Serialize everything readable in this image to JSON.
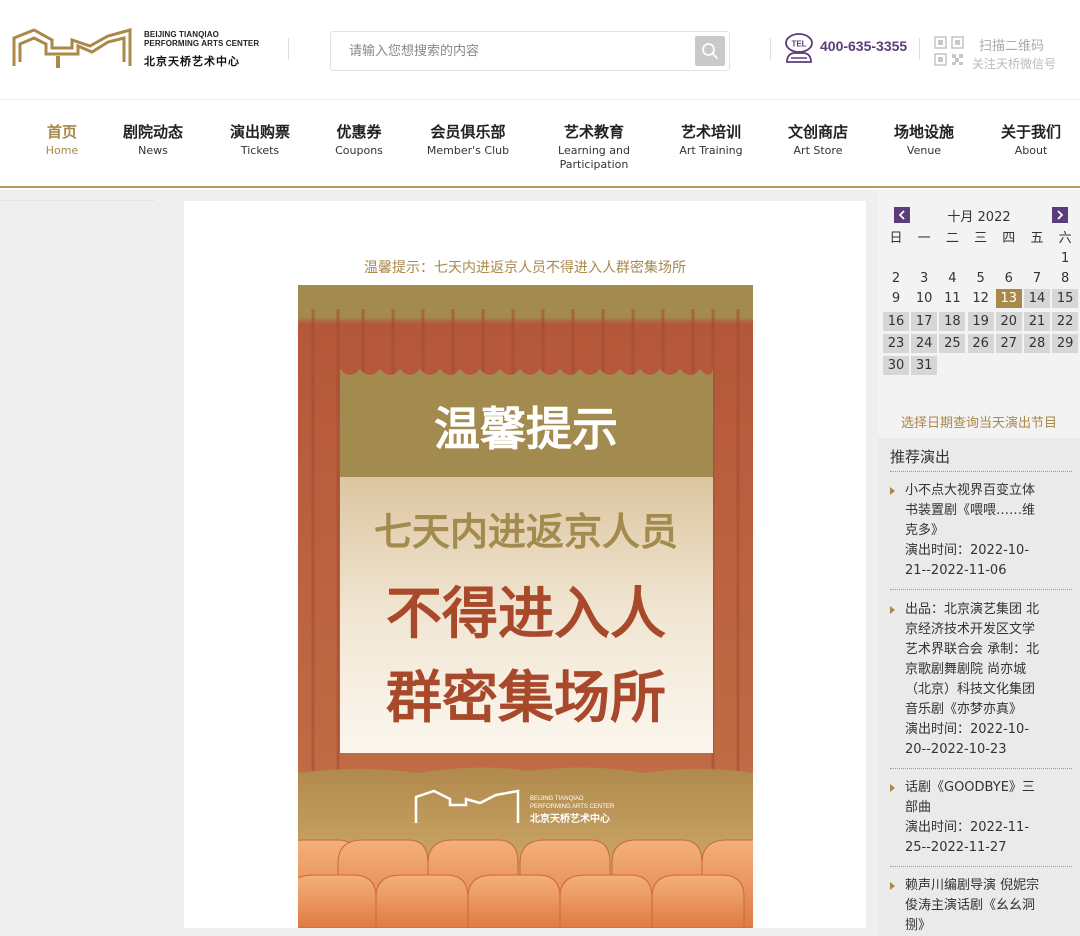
{
  "header": {
    "logo_en_line1": "BEIJING TIANQIAO",
    "logo_en_line2": "PERFORMING ARTS CENTER",
    "logo_cn": "北京天桥艺术中心",
    "search_placeholder": "请输入您想搜索的内容",
    "tel_label": "TEL",
    "phone": "400-635-3355",
    "qr_title": "扫描二维码",
    "qr_subtitle": "关注天桥微信号"
  },
  "nav": [
    {
      "cn": "首页",
      "en": "Home",
      "active": true
    },
    {
      "cn": "剧院动态",
      "en": "News"
    },
    {
      "cn": "演出购票",
      "en": "Tickets"
    },
    {
      "cn": "优惠券",
      "en": "Coupons"
    },
    {
      "cn": "会员俱乐部",
      "en": "Member's Club"
    },
    {
      "cn": "艺术教育",
      "en": "Learning and",
      "en2": "Participation"
    },
    {
      "cn": "艺术培训",
      "en": "Art Training"
    },
    {
      "cn": "文创商店",
      "en": "Art Store"
    },
    {
      "cn": "场地设施",
      "en": "Venue"
    },
    {
      "cn": "关于我们",
      "en": "About"
    }
  ],
  "main": {
    "notice_title": "温馨提示：七天内进返京人员不得进入人群密集场所",
    "poster": {
      "heading": "温馨提示",
      "line1": "七天内进返京人员",
      "line2": "不得进入人",
      "line3": "群密集场所",
      "logo_en_line1": "BEIJING TIANQIAO",
      "logo_en_line2": "PERFORMING ARTS CENTER",
      "logo_cn": "北京天桥艺术中心"
    }
  },
  "calendar": {
    "title": "十月 2022",
    "weekdays": [
      "日",
      "一",
      "二",
      "三",
      "四",
      "五",
      "六"
    ],
    "today": 13,
    "hint": "选择日期查询当天演出节目"
  },
  "recommend": {
    "title": "推荐演出",
    "items": [
      {
        "lines": [
          "小不点大视界百变立体",
          "书装置剧《喂喂……维",
          "克多》",
          "演出时间：2022-10-",
          "21--2022-11-06"
        ]
      },
      {
        "lines": [
          "出品：北京演艺集团 北",
          "京经济技术开发区文学",
          "艺术界联合会 承制：北",
          "京歌剧舞剧院 尚亦城",
          "（北京）科技文化集团",
          "音乐剧《亦梦亦真》",
          "演出时间：2022-10-",
          "20--2022-10-23"
        ]
      },
      {
        "lines": [
          "话剧《GOODBYE》三",
          "部曲",
          "演出时间：2022-11-",
          "25--2022-11-27"
        ]
      },
      {
        "lines": [
          "赖声川编剧导演 倪妮宗",
          "俊涛主演话剧《幺幺洞",
          "捌》"
        ]
      }
    ]
  },
  "colors": {
    "gold": "#a9884a",
    "purple": "#5a3d7a",
    "poster_red": "#b5573a"
  }
}
